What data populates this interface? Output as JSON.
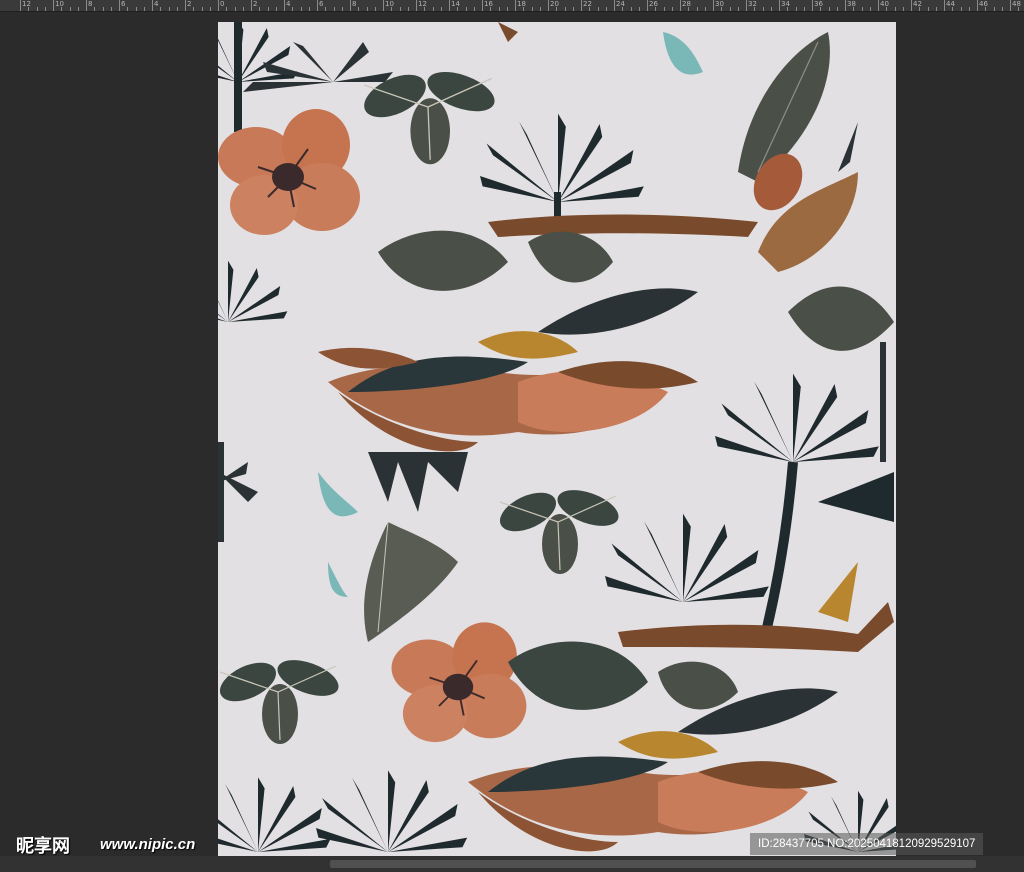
{
  "ruler": {
    "labels": [
      "12",
      "10",
      "8",
      "6",
      "4",
      "2",
      "0",
      "2",
      "4",
      "6",
      "8",
      "10",
      "12",
      "14",
      "16",
      "18",
      "20",
      "22",
      "24",
      "26",
      "28",
      "30",
      "32",
      "34",
      "36",
      "38",
      "40",
      "42",
      "44",
      "46",
      "48"
    ]
  },
  "document": {
    "background_color": "#e3e0e3",
    "palette": {
      "dark_leaf": "#1f2a2e",
      "grey_leaf": "#4a5048",
      "orange_flower": "#c87a58",
      "brown_branch": "#7a4a2c",
      "gold_leaf": "#b8862e",
      "teal_butterfly": "#7ab8b8"
    }
  },
  "watermark": {
    "logo": "昵享网",
    "url": "www.nipic.cn",
    "id_text": "ID:28437705 NO:20250418120929529107"
  }
}
